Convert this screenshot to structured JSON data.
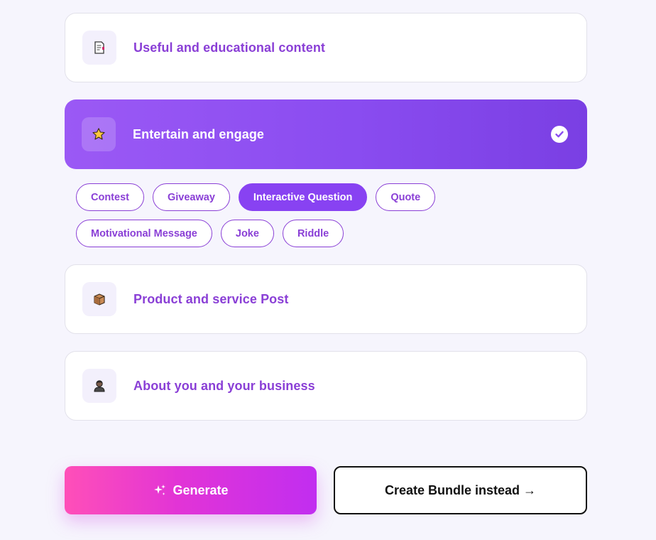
{
  "categories": [
    {
      "label": "Useful and educational content",
      "icon": "document-icon",
      "selected": false
    },
    {
      "label": "Entertain and engage",
      "icon": "star-icon",
      "selected": true
    },
    {
      "label": "Product and service Post",
      "icon": "package-icon",
      "selected": false
    },
    {
      "label": "About you and your business",
      "icon": "person-icon",
      "selected": false
    }
  ],
  "subtypes": {
    "row1": [
      "Contest",
      "Giveaway",
      "Interactive Question",
      "Quote"
    ],
    "row2": [
      "Motivational Message",
      "Joke",
      "Riddle"
    ],
    "active": "Interactive Question"
  },
  "actions": {
    "generate_label": "Generate",
    "bundle_label": "Create Bundle instead →"
  },
  "colors": {
    "accent": "#8a3fd6",
    "selected_card": "#8a4cf0",
    "generate_start": "#ff4fb8",
    "generate_end": "#c12ef0",
    "background": "#f6f5fd"
  }
}
